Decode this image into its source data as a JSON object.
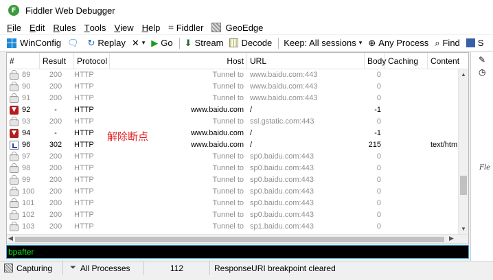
{
  "window": {
    "title": "Fiddler Web Debugger",
    "app_icon_letter": "F"
  },
  "menu": [
    {
      "first": "F",
      "rest": "ile"
    },
    {
      "first": "E",
      "rest": "dit"
    },
    {
      "first": "R",
      "rest": "ules"
    },
    {
      "first": "T",
      "rest": "ools"
    },
    {
      "first": "V",
      "rest": "iew"
    },
    {
      "first": "H",
      "rest": "elp"
    }
  ],
  "menu_extra": {
    "fiddler": "Fiddler",
    "geoedge": "GeoEdge"
  },
  "toolbar": {
    "winconfig": "WinConfig",
    "replay": "Replay",
    "go": "Go",
    "stream": "Stream",
    "decode": "Decode",
    "keep": "Keep: All sessions",
    "any_process": "Any Process",
    "find": "Find",
    "save_fragment": "S"
  },
  "columns": {
    "id": "#",
    "result": "Result",
    "protocol": "Protocol",
    "host": "Host",
    "url": "URL",
    "body": "Body",
    "caching": "Caching",
    "content": "Content"
  },
  "sessions": [
    {
      "id": "89",
      "result": "200",
      "protocol": "HTTP",
      "host": "Tunnel to",
      "url": "www.baidu.com:443",
      "body": "0",
      "content": "",
      "kind": "tun"
    },
    {
      "id": "90",
      "result": "200",
      "protocol": "HTTP",
      "host": "Tunnel to",
      "url": "www.baidu.com:443",
      "body": "0",
      "content": "",
      "kind": "tun"
    },
    {
      "id": "91",
      "result": "200",
      "protocol": "HTTP",
      "host": "Tunnel to",
      "url": "www.baidu.com:443",
      "body": "0",
      "content": "",
      "kind": "tun"
    },
    {
      "id": "92",
      "result": "-",
      "protocol": "HTTP",
      "host": "www.baidu.com",
      "url": "/",
      "body": "-1",
      "content": "",
      "kind": "bp"
    },
    {
      "id": "93",
      "result": "200",
      "protocol": "HTTP",
      "host": "Tunnel to",
      "url": "ssl.gstatic.com:443",
      "body": "0",
      "content": "",
      "kind": "tun"
    },
    {
      "id": "94",
      "result": "-",
      "protocol": "HTTP",
      "host": "www.baidu.com",
      "url": "/",
      "body": "-1",
      "content": "",
      "kind": "bp"
    },
    {
      "id": "96",
      "result": "302",
      "protocol": "HTTP",
      "host": "www.baidu.com",
      "url": "/",
      "body": "215",
      "content": "text/htm",
      "kind": "doc"
    },
    {
      "id": "97",
      "result": "200",
      "protocol": "HTTP",
      "host": "Tunnel to",
      "url": "sp0.baidu.com:443",
      "body": "0",
      "content": "",
      "kind": "tun"
    },
    {
      "id": "98",
      "result": "200",
      "protocol": "HTTP",
      "host": "Tunnel to",
      "url": "sp0.baidu.com:443",
      "body": "0",
      "content": "",
      "kind": "tun"
    },
    {
      "id": "99",
      "result": "200",
      "protocol": "HTTP",
      "host": "Tunnel to",
      "url": "sp0.baidu.com:443",
      "body": "0",
      "content": "",
      "kind": "tun"
    },
    {
      "id": "100",
      "result": "200",
      "protocol": "HTTP",
      "host": "Tunnel to",
      "url": "sp0.baidu.com:443",
      "body": "0",
      "content": "",
      "kind": "tun"
    },
    {
      "id": "101",
      "result": "200",
      "protocol": "HTTP",
      "host": "Tunnel to",
      "url": "sp0.baidu.com:443",
      "body": "0",
      "content": "",
      "kind": "tun"
    },
    {
      "id": "102",
      "result": "200",
      "protocol": "HTTP",
      "host": "Tunnel to",
      "url": "sp0.baidu.com:443",
      "body": "0",
      "content": "",
      "kind": "tun"
    },
    {
      "id": "103",
      "result": "200",
      "protocol": "HTTP",
      "host": "Tunnel to",
      "url": "sp1.baidu.com:443",
      "body": "0",
      "content": "",
      "kind": "tun"
    }
  ],
  "annotation": "解除断点",
  "quickexec": {
    "value": "bpafter"
  },
  "right_pane": {
    "text": "Fle"
  },
  "status": {
    "capturing": "Capturing",
    "processes": "All Processes",
    "count": "112",
    "message": "ResponseURI breakpoint cleared"
  }
}
